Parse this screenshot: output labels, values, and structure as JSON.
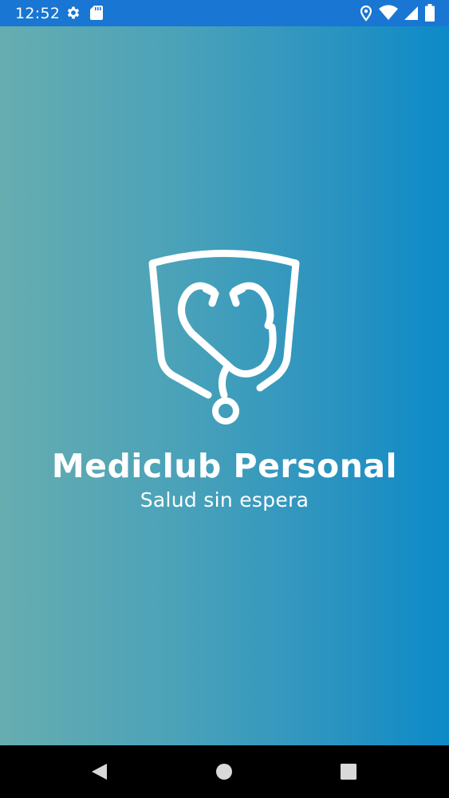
{
  "status_bar": {
    "time": "12:52",
    "left_icons": [
      "settings-gear-icon",
      "sd-card-icon"
    ],
    "right_icons": [
      "location-pin-icon",
      "wifi-icon",
      "cell-signal-icon",
      "battery-icon"
    ],
    "background_color": "#1976d2"
  },
  "splash": {
    "title": "Mediclub Personal",
    "tagline": "Salud sin espera",
    "logo_icon": "shield-stethoscope-heart-icon",
    "gradient_start": "#67adb0",
    "gradient_end": "#0c8ac8"
  },
  "nav_bar": {
    "buttons": [
      "back-icon",
      "home-icon",
      "recents-icon"
    ],
    "background_color": "#000000"
  }
}
